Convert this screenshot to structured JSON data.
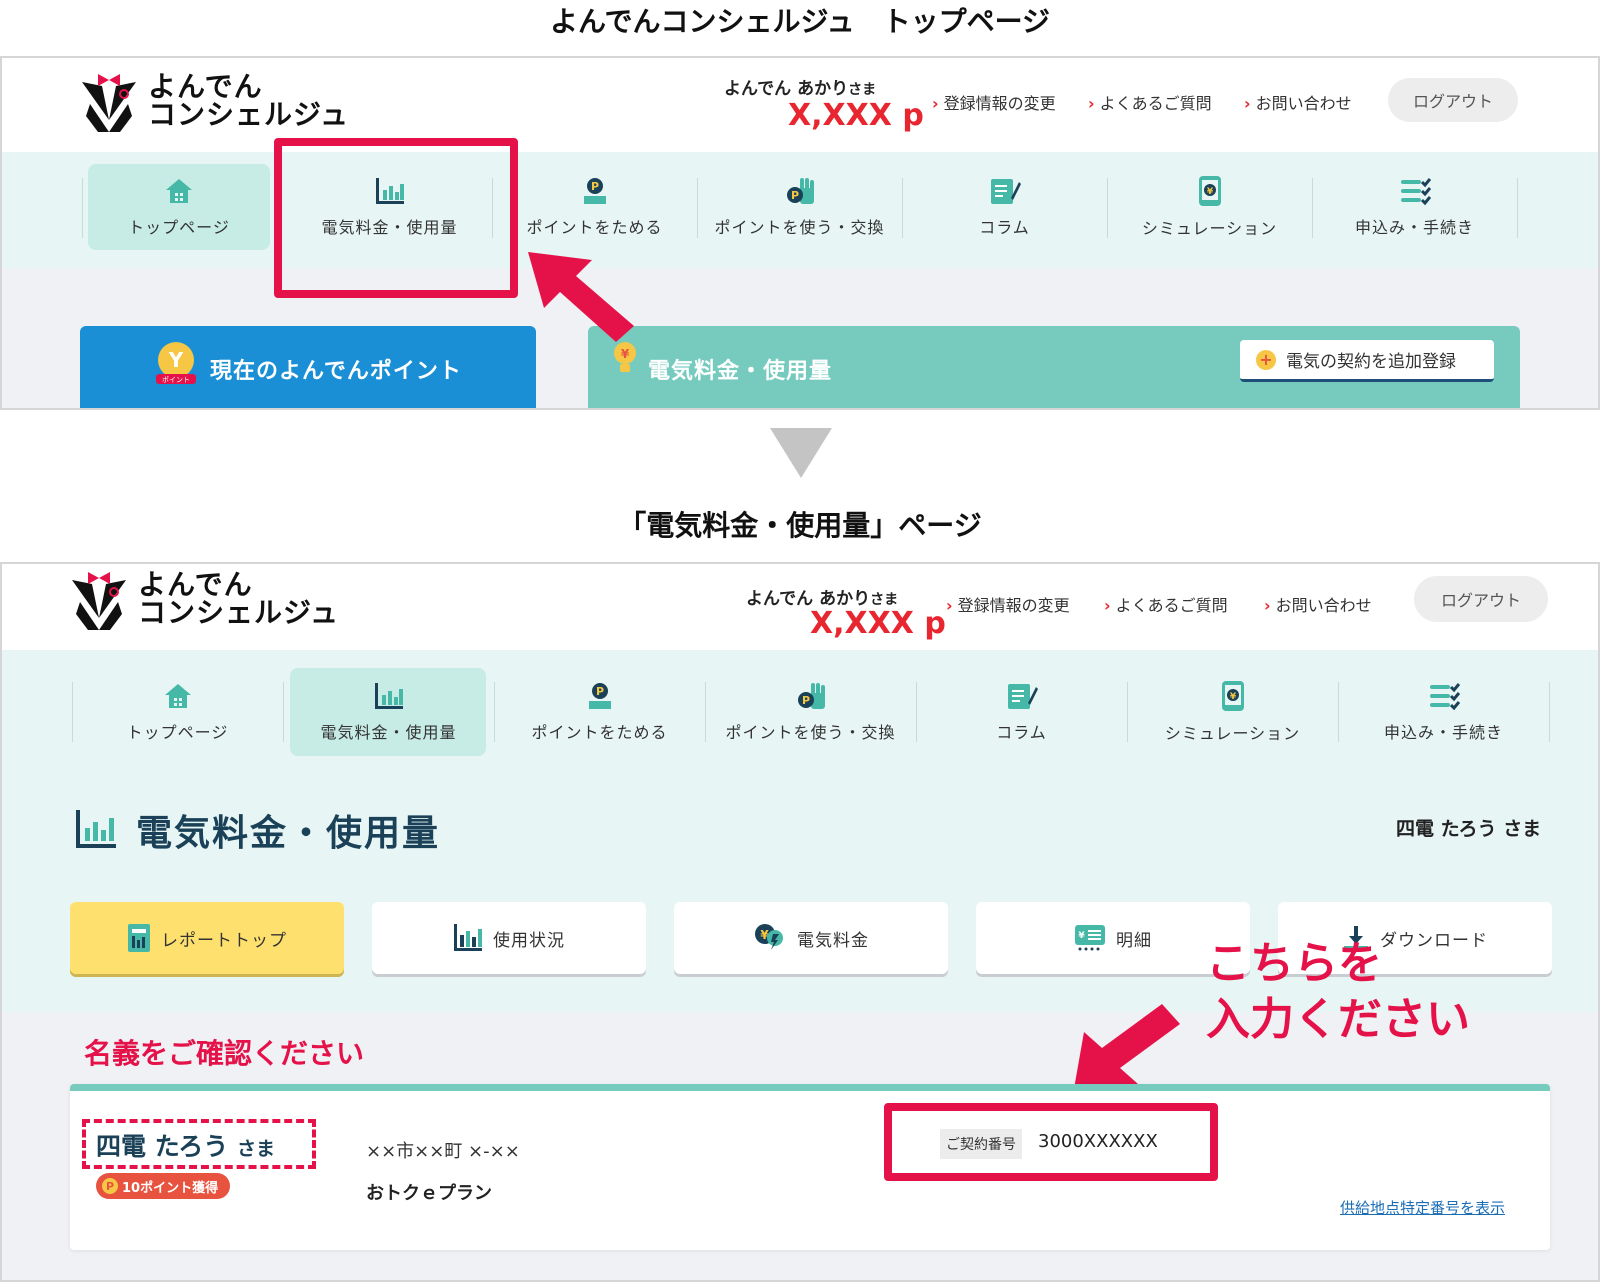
{
  "top_caption": "よんでんコンシェルジュ　トップページ",
  "bottom_caption": "「電気料金・使用量」ページ",
  "brand": {
    "line1": "よんでん",
    "line2": "コンシェルジュ"
  },
  "user": {
    "name": "よんでん あかり",
    "honorific": "さま",
    "points": "X,XXX p"
  },
  "header_links": [
    "登録情報の変更",
    "よくあるご質問",
    "お問い合わせ"
  ],
  "logout_label": "ログアウト",
  "nav_items": [
    {
      "label": "トップページ",
      "icon": "house-icon"
    },
    {
      "label": "電気料金・使用量",
      "icon": "bar-chart-icon"
    },
    {
      "label": "ポイントをためる",
      "icon": "point-coin-icon"
    },
    {
      "label": "ポイントを使う・交換",
      "icon": "point-hand-icon"
    },
    {
      "label": "コラム",
      "icon": "column-pen-icon"
    },
    {
      "label": "シミュレーション",
      "icon": "phone-yen-icon"
    },
    {
      "label": "申込み・手続き",
      "icon": "checklist-icon"
    }
  ],
  "top_panels": {
    "points_title": "現在のよんでんポイント",
    "coin_label": "ポイント",
    "electricity_title": "電気料金・使用量",
    "add_contract_label": "電気の契約を追加登録"
  },
  "page_title": "電気料金・使用量",
  "customer_name": "四電 たろう さま",
  "report_tabs": [
    {
      "label": "レポートトップ",
      "icon": "report-icon"
    },
    {
      "label": "使用状況",
      "icon": "usage-chart-icon"
    },
    {
      "label": "電気料金",
      "icon": "bulb-yen-icon"
    },
    {
      "label": "明細",
      "icon": "statement-icon"
    },
    {
      "label": "ダウンロード",
      "icon": "download-icon"
    }
  ],
  "annotations": {
    "confirm_name": "名義をご確認ください",
    "enter_here_line1": "こちらを",
    "enter_here_line2": "入力ください"
  },
  "contract_card": {
    "name": "四電 たろう",
    "honorific": "さま",
    "badge": "10ポイント獲得",
    "address": "××市××町 ×-××",
    "plan": "おトクｅプラン",
    "contract_label": "ご契約番号",
    "contract_number": "3000XXXXXX",
    "supply_link": "供給地点特定番号を表示"
  },
  "colors": {
    "accent_red": "#e5124a",
    "teal": "#76cbbe",
    "nav_bg": "#e7f6f4",
    "points_blue": "#1a8fd6",
    "navy": "#1a4157",
    "active_tab_yellow": "#fde06e"
  }
}
